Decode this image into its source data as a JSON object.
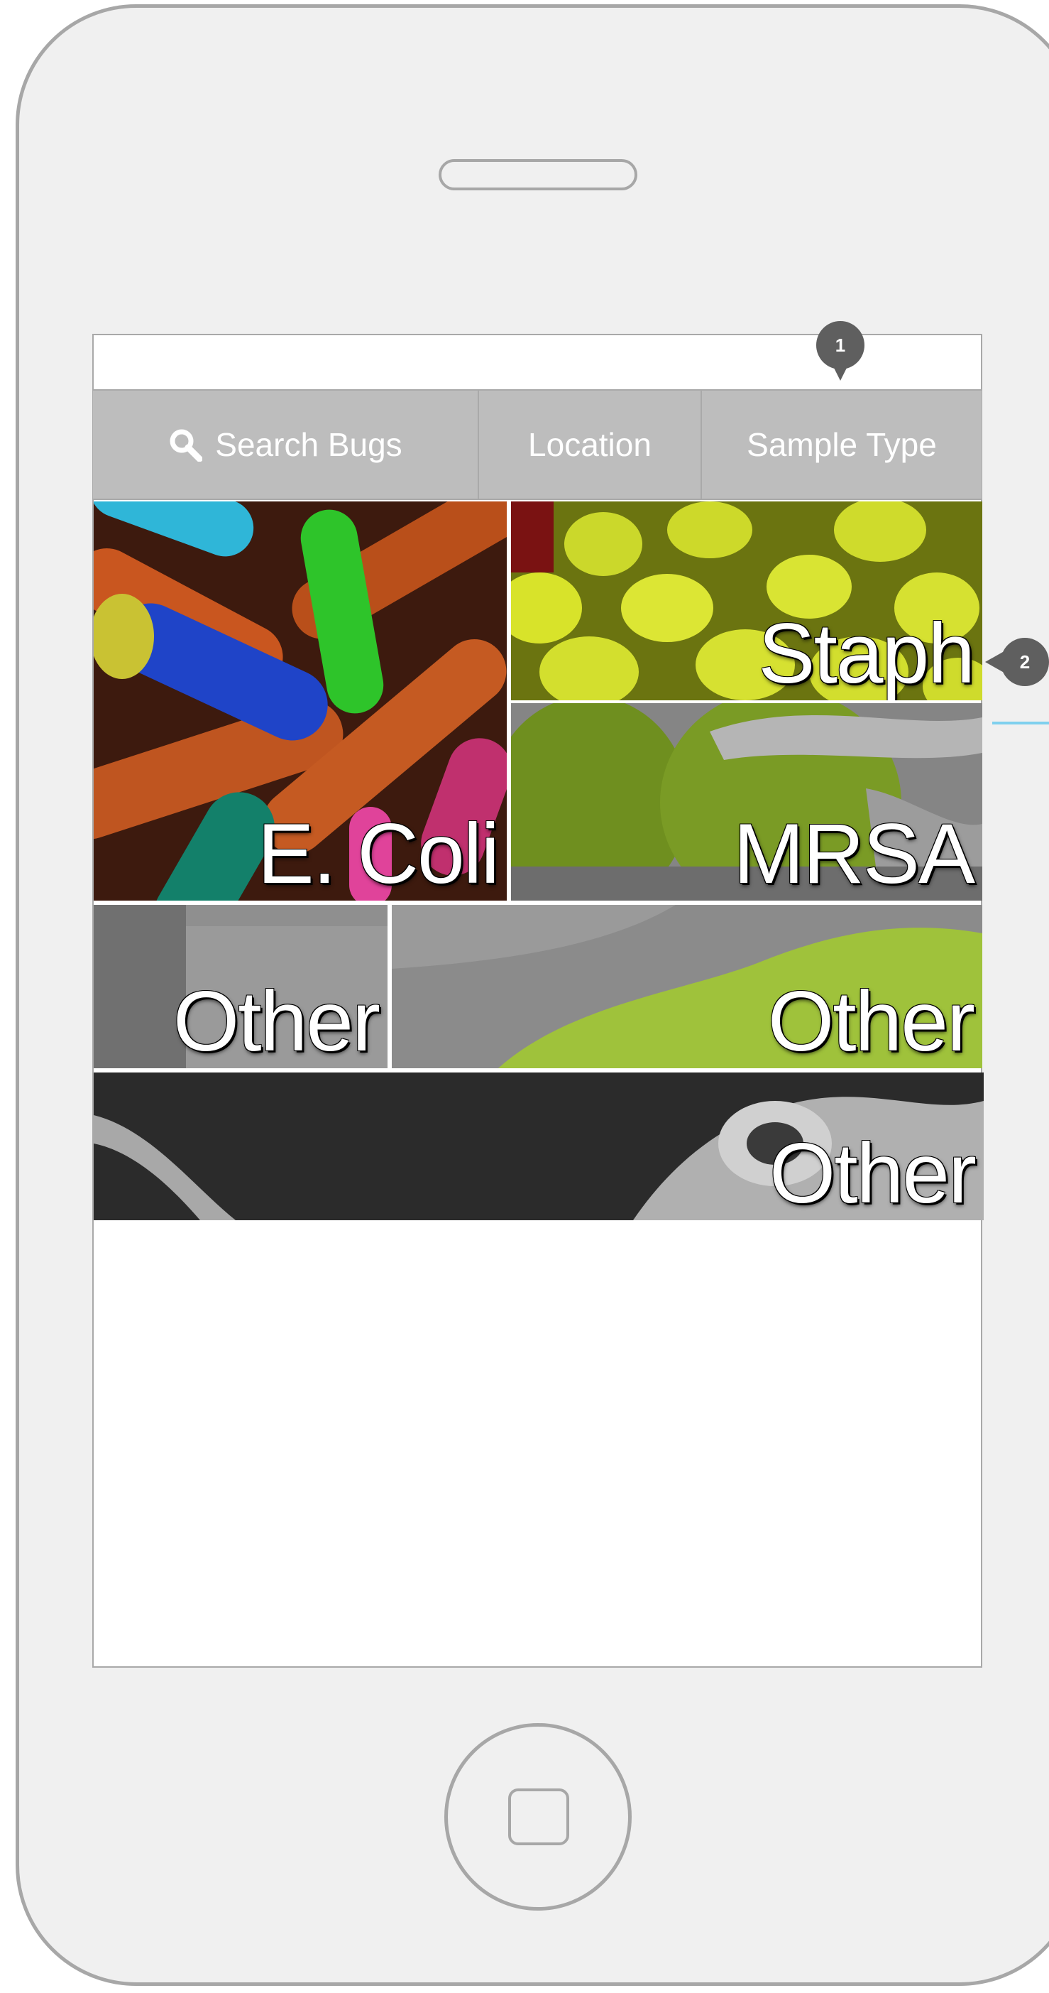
{
  "filter_bar": {
    "search_label": "Search Bugs",
    "location_label": "Location",
    "sample_type_label": "Sample Type"
  },
  "tiles": [
    {
      "label": "E. Coli"
    },
    {
      "label": "Staph"
    },
    {
      "label": "MRSA"
    },
    {
      "label": "Other"
    },
    {
      "label": "Other"
    },
    {
      "label": "Other"
    }
  ],
  "annotations": {
    "marker_1": "1",
    "marker_2": "2"
  },
  "colors": {
    "filter_bar_bg": "#bdbdbd",
    "annotation_marker": "#5f5f5f",
    "connector_line": "#7fd0ee",
    "device_frame": "#f0f0f0"
  },
  "icons": {
    "search": "search-icon"
  }
}
